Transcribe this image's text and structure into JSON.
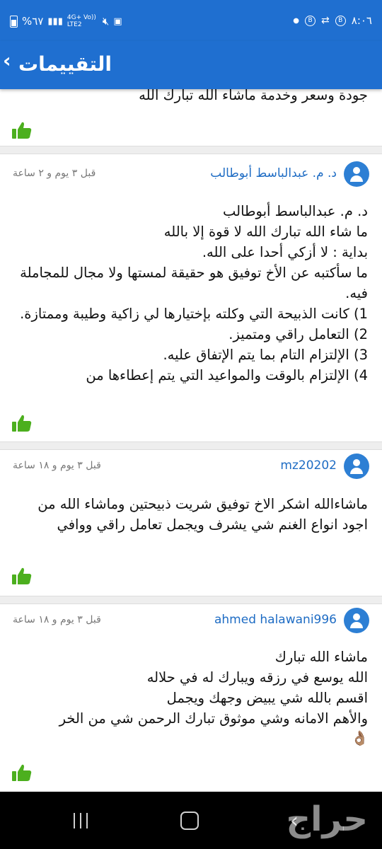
{
  "status_bar": {
    "time": "٨:٠٦",
    "battery": "%٦٧",
    "network": "4G+ Vo)) LTE2",
    "icons": [
      "battery-icon",
      "signal-icon",
      "mute-icon",
      "b-badge-icon",
      "link-icon",
      "dot-icon"
    ]
  },
  "app_bar": {
    "title": "التقييمات",
    "back_icon": "chevron-back-icon"
  },
  "reviews": [
    {
      "body": "جودة وسعر وخدمة ماشاء الله تبارك الله"
    },
    {
      "user": "د. م. عبدالباسط أبوطالب",
      "time": "قبل ٣ يوم و ٢ ساعة",
      "body": "د. م. عبدالباسط أبوطالب\nما شاء الله تبارك الله لا قوة إلا بالله\nبداية : لا أزكي أحدا على الله.\nما سأكتبه عن الأخ توفيق هو حقيقة لمستها ولا مجال للمجاملة فيه.\n1) كانت الذبيحة التي وكلته بإختيارها لي زاكية وطيبة وممتازة.\n2) التعامل راقي ومتميز.\n3) الإلتزام التام بما يتم الإتفاق عليه.\n4) الإلتزام بالوقت والمواعيد التي يتم إعطاءها من"
    },
    {
      "user": "mz20202",
      "time": "قبل ٣ يوم و ١٨ ساعة",
      "body": "ماشاءالله اشكر الاخ توفيق شريت ذبيحتين وماشاء الله من اجود انواع الغنم شي يشرف ويجمل تعامل راقي ووافي"
    },
    {
      "user": "ahmed halawani996",
      "time": "قبل ٣ يوم و ١٨ ساعة",
      "body": "ماشاء الله تبارك\nالله يوسع في رزقه ويبارك له في حلاله\nاقسم بالله شي يبيض وجهك ويجمل\nوالأهم الامانه وشي موثوق تبارك الرحمن شي من الخر",
      "emoji": "👌🏽"
    }
  ],
  "watermark_text": "حراج",
  "colors": {
    "primary": "#1f6fd0",
    "link": "#1e6cc4",
    "like_green": "#4caf1e"
  }
}
